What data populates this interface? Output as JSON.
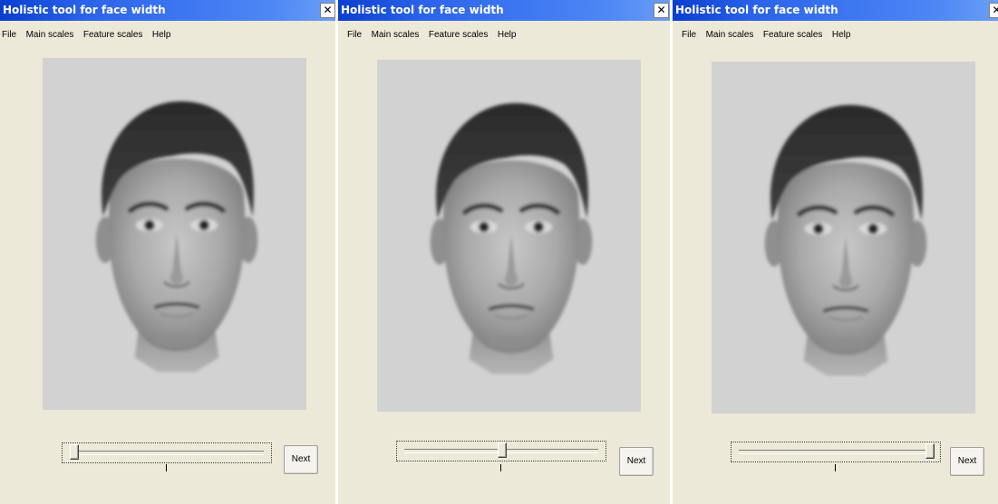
{
  "windows": [
    {
      "title": "Holistic tool for face width",
      "close_icon": "close-icon",
      "menu": [
        "File",
        "Main scales",
        "Feature scales",
        "Help"
      ],
      "image": "face-portrait",
      "slider_value": 0.0,
      "next_label": "Next"
    },
    {
      "title": "Holistic tool for face width",
      "close_icon": "close-icon",
      "menu": [
        "File",
        "Main scales",
        "Feature scales",
        "Help"
      ],
      "image": "face-portrait",
      "slider_value": 0.5,
      "next_label": "Next"
    },
    {
      "title": "Holistic tool for face width",
      "close_icon": "close-icon",
      "menu": [
        "File",
        "Main scales",
        "Feature scales",
        "Help"
      ],
      "image": "face-portrait",
      "slider_value": 1.0,
      "next_label": "Next"
    }
  ],
  "colors": {
    "titlebar": "#2a63ea",
    "window_bg": "#ece9d8",
    "image_bg": "#d2d2d2"
  }
}
